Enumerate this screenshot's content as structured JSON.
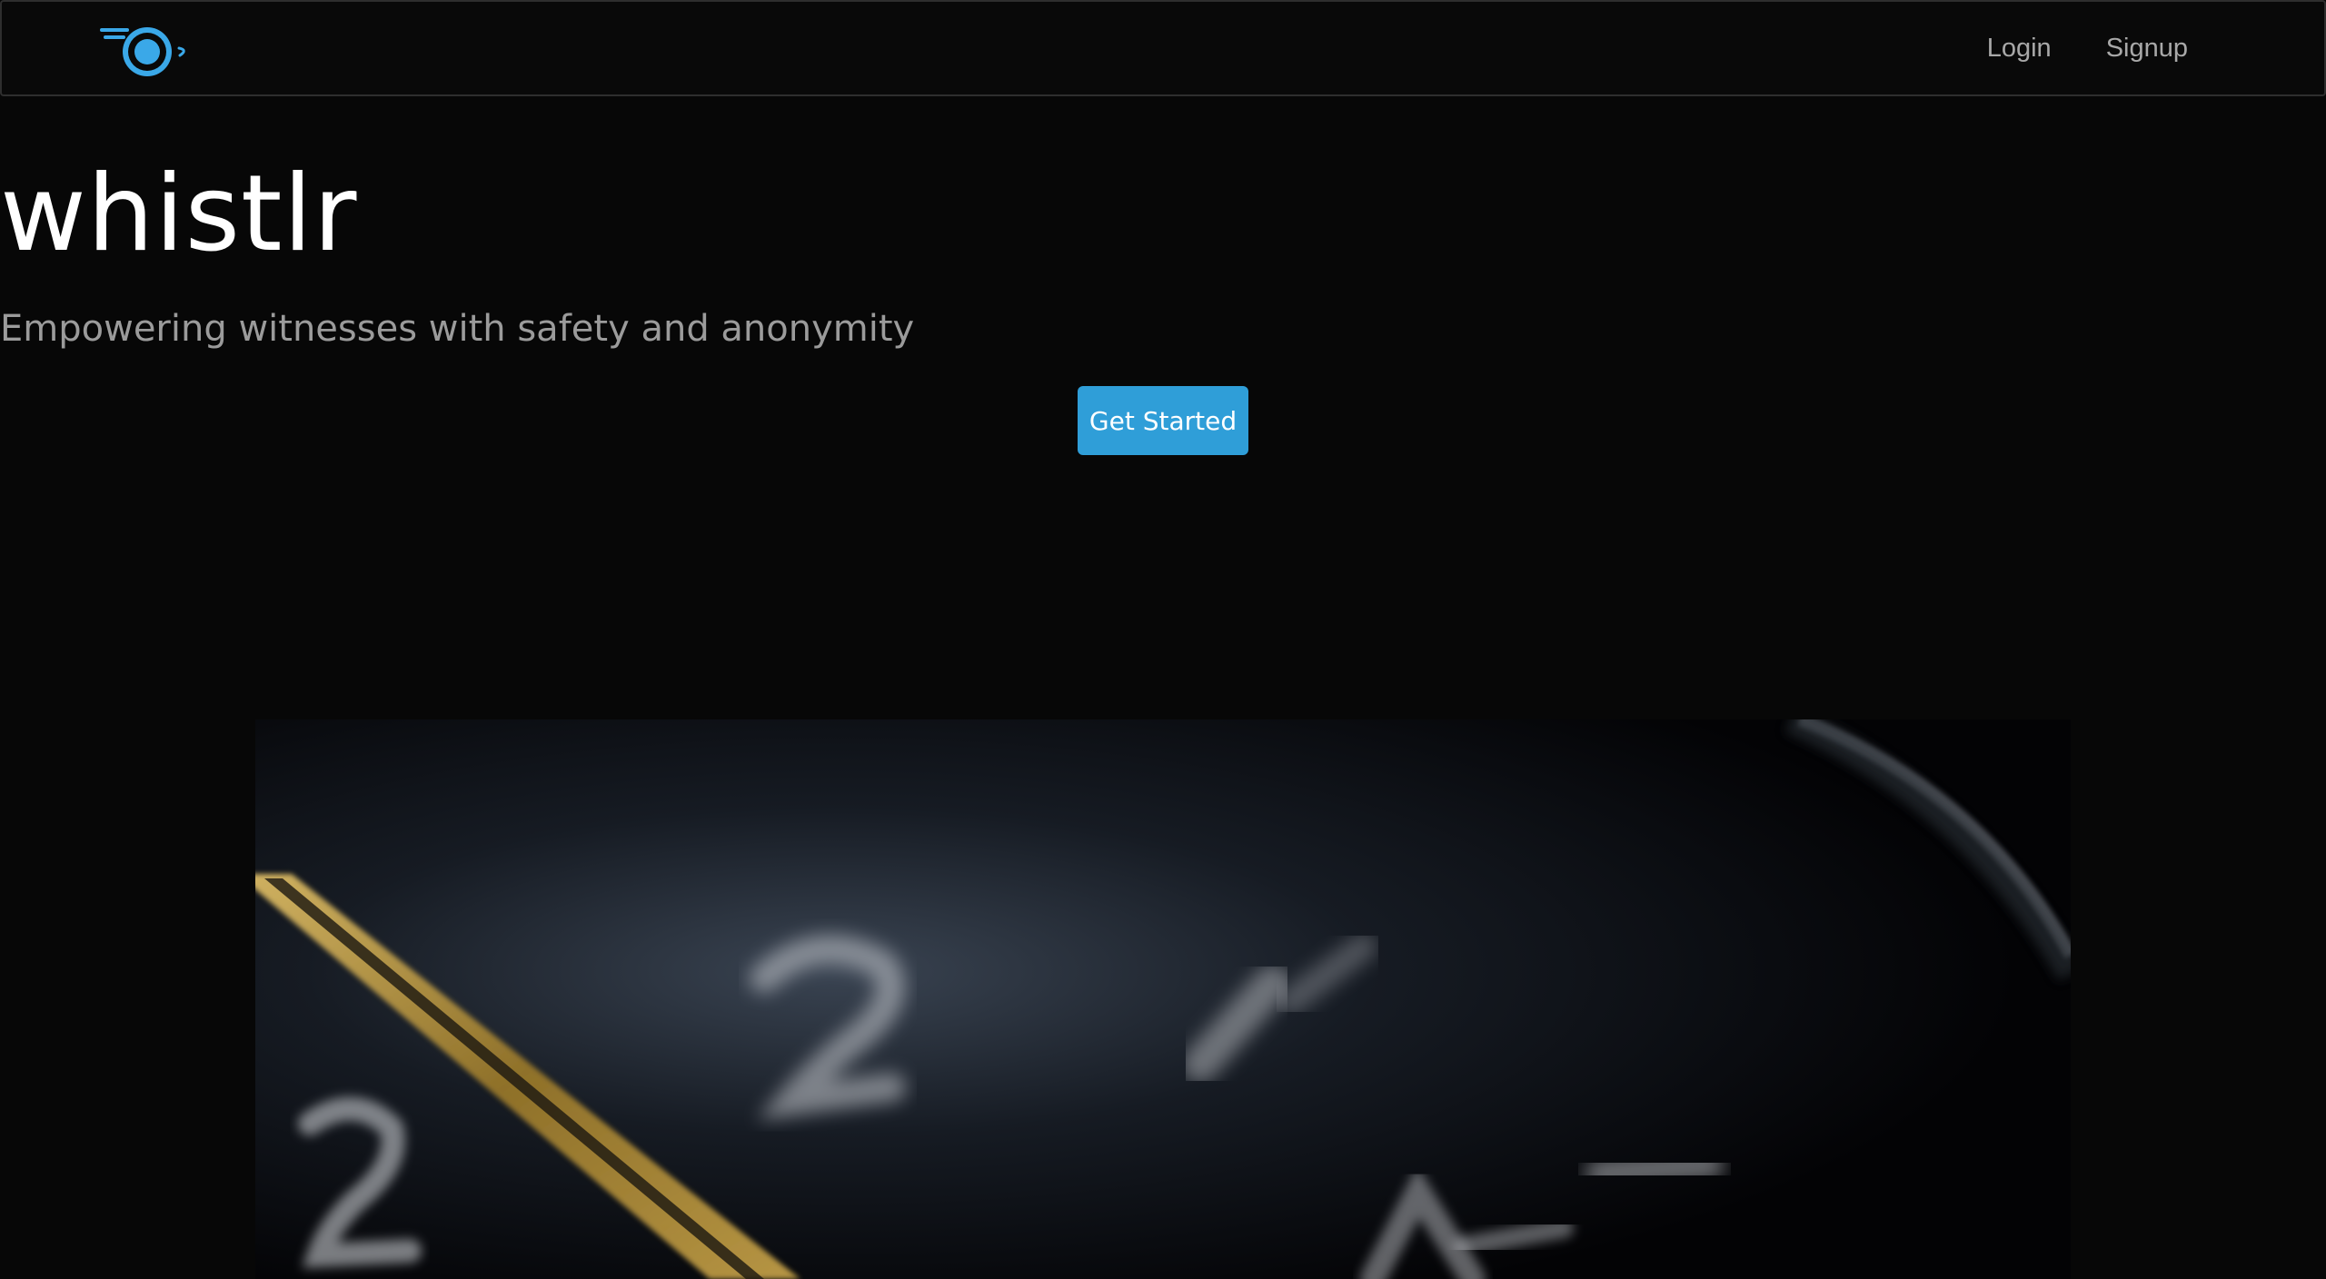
{
  "nav": {
    "logo_icon": "whistle-logo-icon",
    "login_label": "Login",
    "signup_label": "Signup"
  },
  "hero": {
    "title": "whistlr",
    "subtitle": "Empowering witnesses with safety and anonymity",
    "cta_label": "Get Started"
  },
  "colors": {
    "background": "#070707",
    "accent": "#2f9ed8",
    "logo": "#3aa8e8",
    "title": "#ffffff",
    "subtitle": "#9b9b9b",
    "nav_link": "#a8a8a8"
  },
  "media": {
    "hero_image_subject": "close-up of a dark watch dial with blurred numerals and a gold hand"
  }
}
